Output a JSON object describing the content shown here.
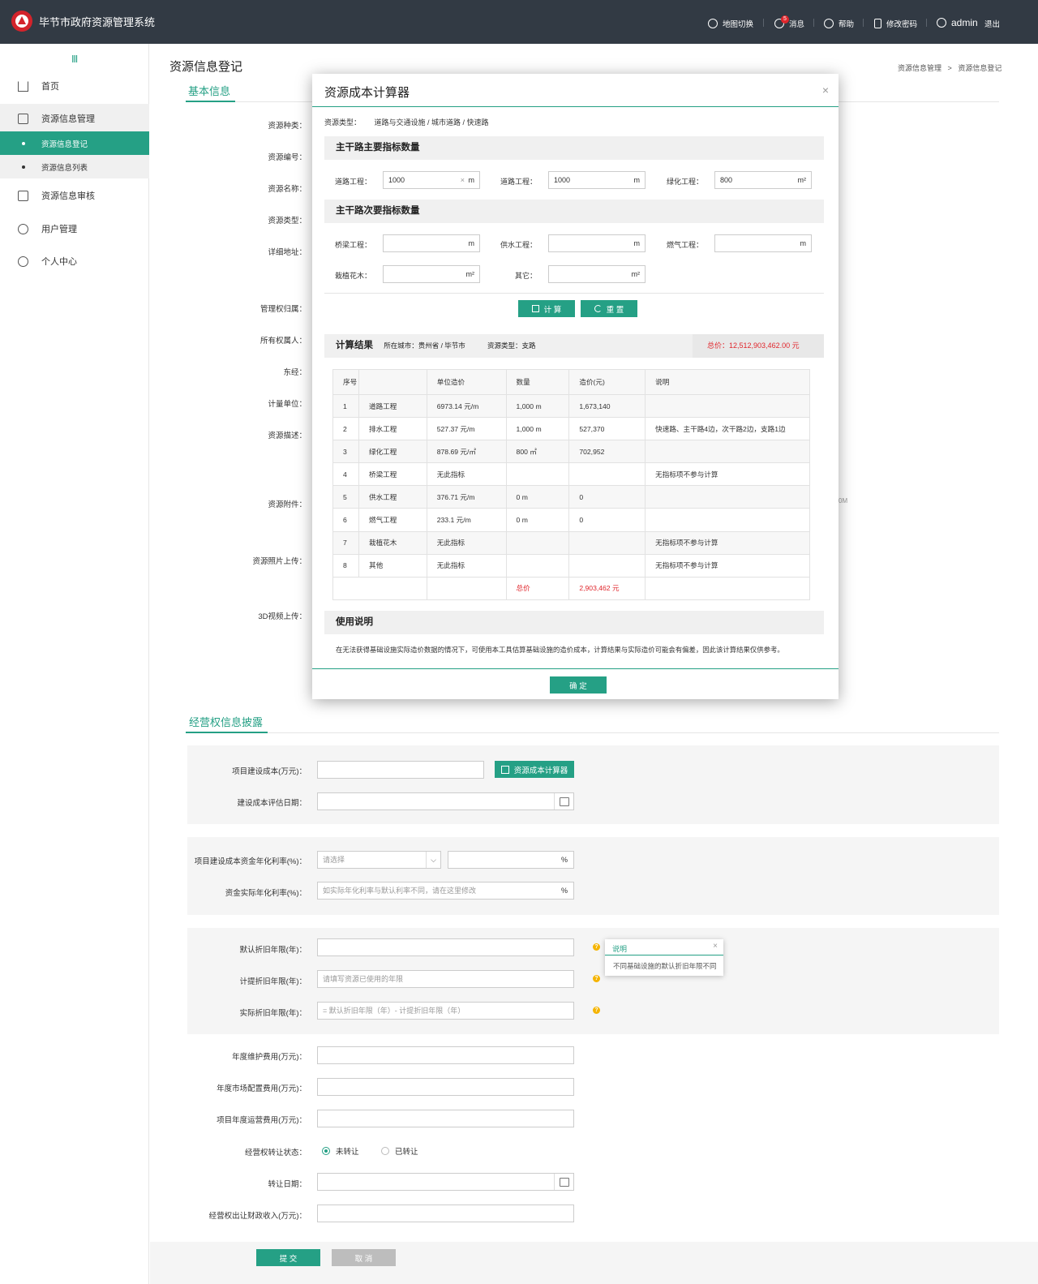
{
  "header": {
    "app_title": "毕节市政府资源管理系统",
    "nav": {
      "map_switch": "地图切换",
      "messages": "消息",
      "message_count": "5",
      "help": "帮助",
      "change_password": "修改密码",
      "username": "admin",
      "logout": "退出"
    }
  },
  "sidebar": {
    "toggle_icon": "Ⅲ",
    "items": [
      {
        "label": "首页",
        "icon": "home-icon"
      },
      {
        "label": "资源信息管理",
        "icon": "edit-icon"
      },
      {
        "label": "资源信息审核",
        "icon": "audit-icon"
      },
      {
        "label": "用户管理",
        "icon": "users-icon"
      },
      {
        "label": "个人中心",
        "icon": "user-icon"
      }
    ],
    "sub_items": [
      {
        "label": "资源信息登记",
        "active": true
      },
      {
        "label": "资源信息列表",
        "active": false
      }
    ]
  },
  "page": {
    "title": "资源信息登记",
    "breadcrumb": {
      "parent": "资源信息管理",
      "separator": ">",
      "current": "资源信息登记"
    }
  },
  "basic_info": {
    "section_title": "基本信息",
    "labels": [
      "资源种类：",
      "资源编号：",
      "资源名称：",
      "资源类型：",
      "详细地址：",
      "管理权归属：",
      "所有权属人：",
      "东经：",
      "计量单位：",
      "资源描述：",
      "资源附件：",
      "资源照片上传：",
      "3D视频上传："
    ],
    "attachment_hint_fragment": "0M"
  },
  "modal": {
    "title": "资源成本计算器",
    "close": "×",
    "resource_type_label": "资源类型：",
    "resource_type_value": "道路与交通设施 / 城市道路 / 快速路",
    "primary_section": "主干路主要指标数量",
    "primary_fields": [
      {
        "label": "道路工程：",
        "value": "1000",
        "unit": "m",
        "clear": "×"
      },
      {
        "label": "道路工程：",
        "value": "1000",
        "unit": "m"
      },
      {
        "label": "绿化工程：",
        "value": "800",
        "unit": "m²"
      }
    ],
    "secondary_section": "主干路次要指标数量",
    "secondary_fields": [
      {
        "label": "桥梁工程：",
        "value": "",
        "unit": "m"
      },
      {
        "label": "供水工程：",
        "value": "",
        "unit": "m"
      },
      {
        "label": "燃气工程：",
        "value": "",
        "unit": "m"
      },
      {
        "label": "栽植花木：",
        "value": "",
        "unit": "m²"
      },
      {
        "label": "其它：",
        "value": "",
        "unit": "m²"
      }
    ],
    "calc_button": "计 算",
    "reset_button": "重 置",
    "result_title": "计算结果",
    "result_city_label": "所在城市：",
    "result_city": "贵州省 / 毕节市",
    "result_type_label": "资源类型：",
    "result_type": "支路",
    "result_total_label": "总价：",
    "result_total": "12,512,903,462.00 元",
    "table": {
      "headers": [
        "序号",
        "",
        "单位造价",
        "数量",
        "造价(元)",
        "说明"
      ],
      "rows": [
        [
          "1",
          "道路工程",
          "6973.14 元/m",
          "1,000 m",
          "1,673,140",
          ""
        ],
        [
          "2",
          "排水工程",
          "527.37 元/m",
          "1,000 m",
          "527,370",
          "快速路、主干路4边，次干路2边，支路1边"
        ],
        [
          "3",
          "绿化工程",
          "878.69 元/㎡",
          "800 ㎡",
          "702,952",
          ""
        ],
        [
          "4",
          "桥梁工程",
          "无此指标",
          "",
          "",
          "无指标项不参与计算"
        ],
        [
          "5",
          "供水工程",
          "376.71 元/m",
          "0 m",
          "0",
          ""
        ],
        [
          "6",
          "燃气工程",
          "233.1 元/m",
          "0 m",
          "0",
          ""
        ],
        [
          "7",
          "栽植花木",
          "无此指标",
          "",
          "",
          "无指标项不参与计算"
        ],
        [
          "8",
          "其他",
          "无此指标",
          "",
          "",
          "无指标项不参与计算"
        ]
      ],
      "total_label": "总价",
      "total_value": "2,903,462 元"
    },
    "usage_title": "使用说明",
    "usage_text": "在无法获得基础设施实际造价数据的情况下，可使用本工具估算基础设施的造价成本，计算结果与实际造价可能会有偏差，因此该计算结果仅供参考。",
    "confirm_button": "确 定"
  },
  "operation": {
    "section_title": "经营权信息披露",
    "cost_label": "项目建设成本(万元)：",
    "cost_value": "",
    "calculator_button": "资源成本计算器",
    "eval_date_label": "建设成本评估日期：",
    "rate_label": "项目建设成本资金年化利率(%)：",
    "rate_select_placeholder": "请选择",
    "rate_unit": "%",
    "actual_rate_label": "资金实际年化利率(%)：",
    "actual_rate_placeholder": "如实际年化利率与默认利率不同，请在这里修改",
    "default_dep_label": "默认折旧年限(年)：",
    "accrued_dep_label": "计提折旧年限(年)：",
    "accrued_dep_placeholder": "请填写资源已使用的年限",
    "actual_dep_label": "实际折旧年限(年)：",
    "actual_dep_placeholder": "= 默认折旧年限（年）- 计提折旧年限（年）",
    "tooltip_title": "说明",
    "tooltip_close": "×",
    "tooltip_text": "不同基础设施的默认折旧年限不同",
    "qmark": "?",
    "maintenance_label": "年度维护费用(万元)：",
    "market_label": "年度市场配置费用(万元)：",
    "operating_label": "项目年度运营费用(万元)：",
    "transfer_status_label": "经营权转让状态：",
    "transfer_options": [
      "未转让",
      "已转让"
    ],
    "transfer_selected": "未转让",
    "transfer_date_label": "转让日期：",
    "transfer_income_label": "经营权出让财政收入(万元)："
  },
  "footer": {
    "submit": "提 交",
    "cancel": "取 消"
  },
  "colors": {
    "accent": "#25a085",
    "header_bg": "#323a44",
    "danger": "#e0262c",
    "warning": "#f5b400"
  }
}
